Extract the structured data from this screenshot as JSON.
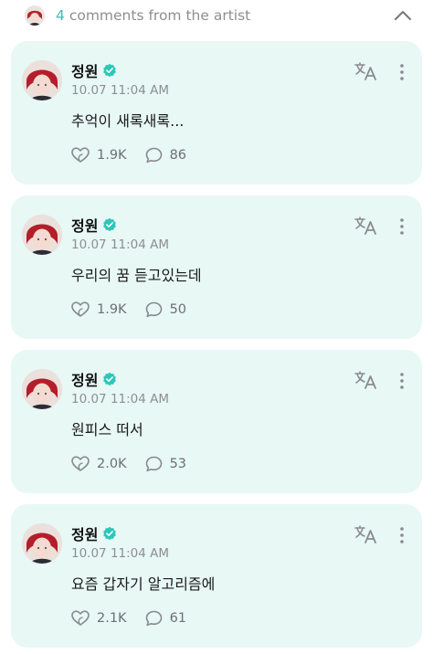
{
  "header": {
    "count": "4",
    "label": "comments from the artist"
  },
  "colors": {
    "accent": "#2ec6b8",
    "card_background": "#e7f8f5",
    "muted_text": "#8e8e93"
  },
  "icons": [
    "avatar",
    "chevron-up-icon",
    "verified-badge-icon",
    "translate-icon",
    "more-vertical-icon",
    "like-icon",
    "comment-icon"
  ],
  "comments": [
    {
      "author": "정원",
      "time": "10.07 11:04 AM",
      "text": "추억이 새록새록...",
      "likes": "1.9K",
      "replies": "86"
    },
    {
      "author": "정원",
      "time": "10.07 11:04 AM",
      "text": "우리의 꿈 듣고있는데",
      "likes": "1.9K",
      "replies": "50"
    },
    {
      "author": "정원",
      "time": "10.07 11:04 AM",
      "text": "원피스 떠서",
      "likes": "2.0K",
      "replies": "53"
    },
    {
      "author": "정원",
      "time": "10.07 11:04 AM",
      "text": "요즘 갑자기 알고리즘에",
      "likes": "2.1K",
      "replies": "61"
    }
  ]
}
